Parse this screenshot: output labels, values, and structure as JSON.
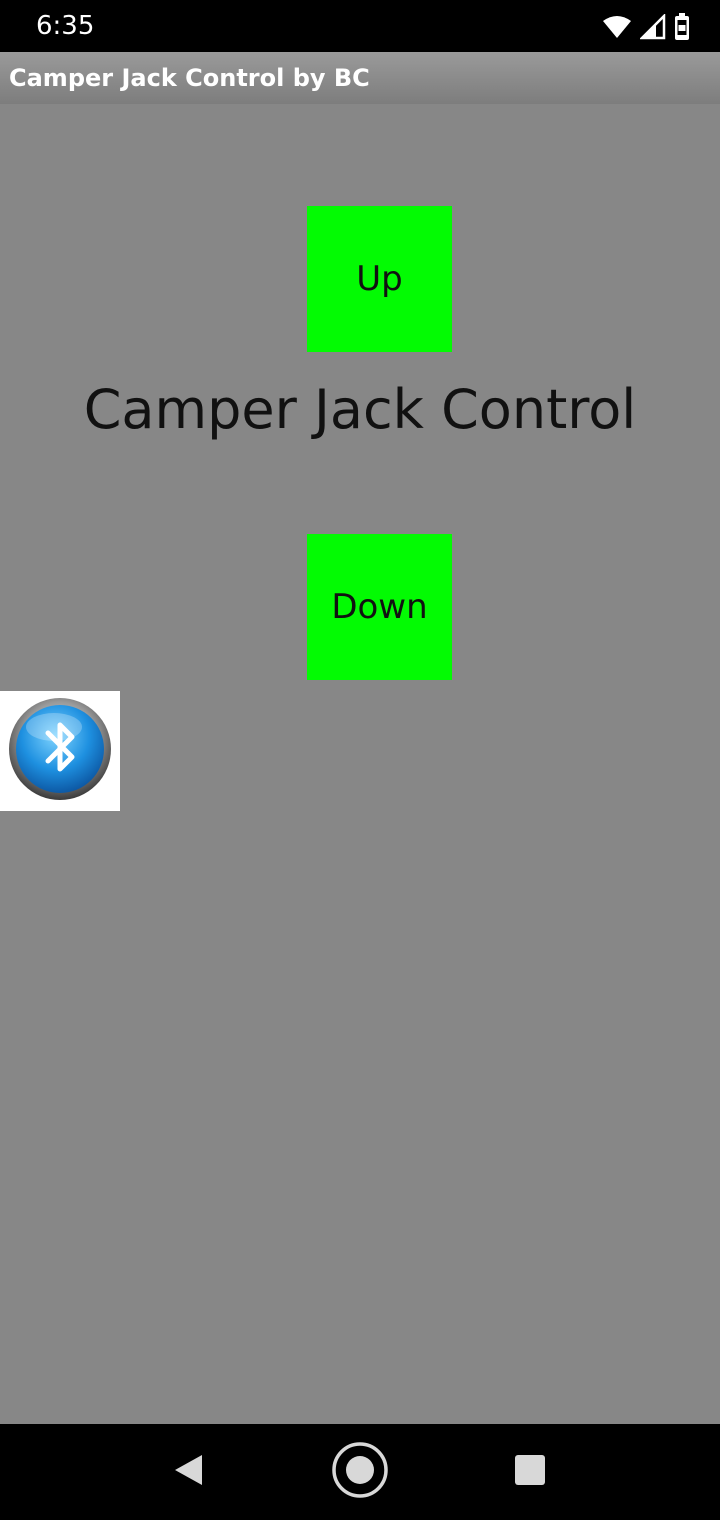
{
  "status_bar": {
    "time": "6:35",
    "icons": [
      "wifi-icon",
      "cell-signal-icon",
      "battery-icon"
    ],
    "background": "#000000"
  },
  "title_bar": {
    "title": "Camper Jack Control by BC"
  },
  "main": {
    "heading": "Camper Jack Control",
    "up_label": "Up",
    "down_label": "Down",
    "button_color": "#03fb03",
    "background": "#878787",
    "bluetooth_icon": "bluetooth-icon"
  },
  "nav_bar": {
    "icons": [
      "back-icon",
      "home-icon",
      "recents-icon"
    ]
  }
}
